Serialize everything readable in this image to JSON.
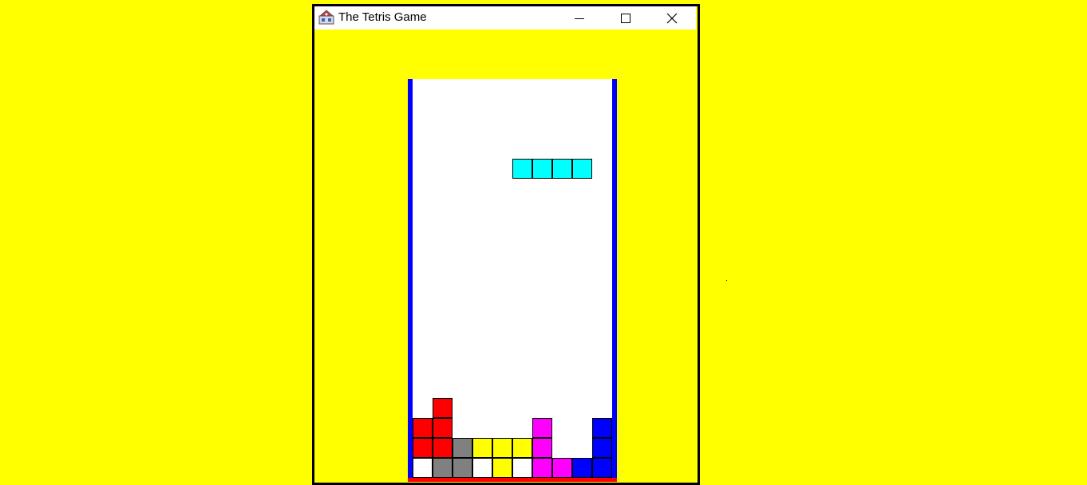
{
  "window": {
    "title": "The Tetris Game",
    "icon": "java-app-icon",
    "controls": {
      "minimize_icon": "minimize-icon",
      "maximize_icon": "maximize-icon",
      "close_icon": "close-icon"
    }
  },
  "colors": {
    "background": "#ffff00",
    "walls": "#0000ff",
    "floor": "#ff0000",
    "well": "#ffffff"
  },
  "board": {
    "columns": 10,
    "rows": 20,
    "falling_piece": {
      "shape": "I",
      "color": "#00ffff",
      "cells": [
        {
          "col": 5,
          "row": 4
        },
        {
          "col": 6,
          "row": 4
        },
        {
          "col": 7,
          "row": 4
        },
        {
          "col": 8,
          "row": 4
        }
      ]
    },
    "locked_cells": [
      {
        "col": 1,
        "row": 16,
        "color": "#ff0000"
      },
      {
        "col": 0,
        "row": 17,
        "color": "#ff0000"
      },
      {
        "col": 1,
        "row": 17,
        "color": "#ff0000"
      },
      {
        "col": 6,
        "row": 17,
        "color": "#ff00ff"
      },
      {
        "col": 9,
        "row": 17,
        "color": "#0000ff"
      },
      {
        "col": 0,
        "row": 18,
        "color": "#ff0000"
      },
      {
        "col": 1,
        "row": 18,
        "color": "#ff0000"
      },
      {
        "col": 2,
        "row": 18,
        "color": "#808080"
      },
      {
        "col": 3,
        "row": 18,
        "color": "#ffff00"
      },
      {
        "col": 4,
        "row": 18,
        "color": "#ffff00"
      },
      {
        "col": 5,
        "row": 18,
        "color": "#ffff00"
      },
      {
        "col": 6,
        "row": 18,
        "color": "#ff00ff"
      },
      {
        "col": 9,
        "row": 18,
        "color": "#0000ff"
      },
      {
        "col": 0,
        "row": 19,
        "color": "#ffffff"
      },
      {
        "col": 1,
        "row": 19,
        "color": "#808080"
      },
      {
        "col": 2,
        "row": 19,
        "color": "#808080"
      },
      {
        "col": 3,
        "row": 19,
        "color": "#ffffff"
      },
      {
        "col": 4,
        "row": 19,
        "color": "#ffff00"
      },
      {
        "col": 5,
        "row": 19,
        "color": "#ffffff"
      },
      {
        "col": 6,
        "row": 19,
        "color": "#ff00ff"
      },
      {
        "col": 7,
        "row": 19,
        "color": "#ff00ff"
      },
      {
        "col": 8,
        "row": 19,
        "color": "#0000ff"
      },
      {
        "col": 9,
        "row": 19,
        "color": "#0000ff"
      }
    ]
  }
}
